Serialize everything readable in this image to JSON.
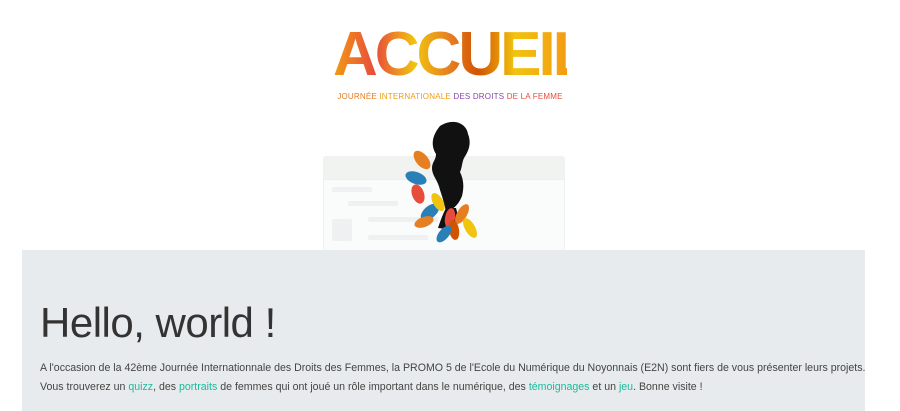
{
  "header": {
    "logo_title": "ACCUEIL",
    "subtitle_parts": [
      "JOURNÉE ",
      "INTERNATIONALE ",
      "DES DROITS ",
      "DE LA FEMME"
    ]
  },
  "illustration": {
    "icon": "woman-silhouette-with-leaves-icon"
  },
  "jumbotron": {
    "title": "Hello, world !",
    "paragraph1": "A l'occasion de la 42ème Journée Internationnale des Droits des Femmes, la PROMO 5 de l'Ecole du Numérique du Noyonnais (E2N) sont fiers de vous présenter leurs projets.",
    "p2_before_quizz": "Vous trouverez un ",
    "link_quizz": "quizz",
    "p2_between_1": ", des ",
    "link_portraits": "portraits",
    "p2_between_2": " de femmes qui ont joué un rôle important dans le numérique, des ",
    "link_temoignages": "témoignages",
    "p2_between_3": " et un ",
    "link_jeu": "jeu",
    "p2_end": ". Bonne visite !"
  },
  "colors": {
    "link": "#18bc9c",
    "jumbotron_bg": "#e8ebed",
    "logo_orange": "#f39c12",
    "logo_purple": "#8e44ad"
  }
}
